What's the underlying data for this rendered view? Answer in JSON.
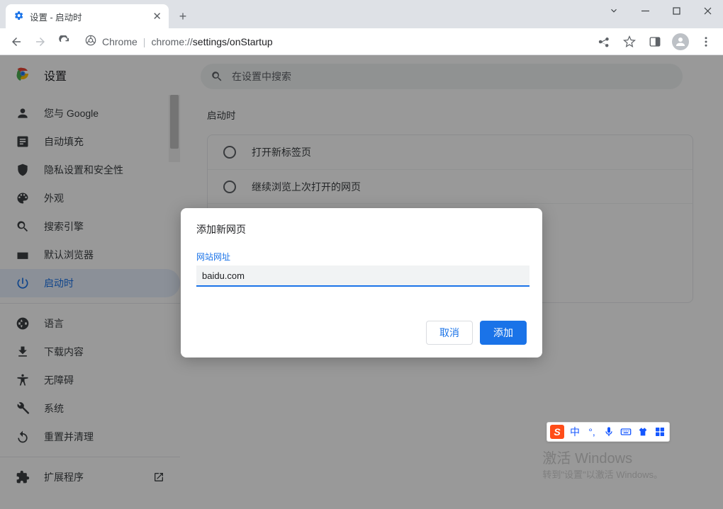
{
  "tab": {
    "title": "设置 - 启动时"
  },
  "omnibox": {
    "chrome_label": "Chrome",
    "url_prefix": "chrome://",
    "url_path": "settings/onStartup"
  },
  "header": {
    "title": "设置"
  },
  "search": {
    "placeholder": "在设置中搜索"
  },
  "sidebar": {
    "items": [
      {
        "label": "您与 Google"
      },
      {
        "label": "自动填充"
      },
      {
        "label": "隐私设置和安全性"
      },
      {
        "label": "外观"
      },
      {
        "label": "搜索引擎"
      },
      {
        "label": "默认浏览器"
      },
      {
        "label": "启动时"
      }
    ],
    "items2": [
      {
        "label": "语言"
      },
      {
        "label": "下载内容"
      },
      {
        "label": "无障碍"
      },
      {
        "label": "系统"
      },
      {
        "label": "重置并清理"
      }
    ],
    "extensions_label": "扩展程序"
  },
  "content": {
    "section_label": "启动时",
    "options": [
      "打开新标签页",
      "继续浏览上次打开的网页"
    ]
  },
  "dialog": {
    "title": "添加新网页",
    "field_label": "网站网址",
    "input_value": "baidu.com",
    "cancel": "取消",
    "confirm": "添加"
  },
  "ime": {
    "zh": "中"
  },
  "watermark": {
    "line1": "激活 Windows",
    "line2": "转到\"设置\"以激活 Windows。"
  }
}
